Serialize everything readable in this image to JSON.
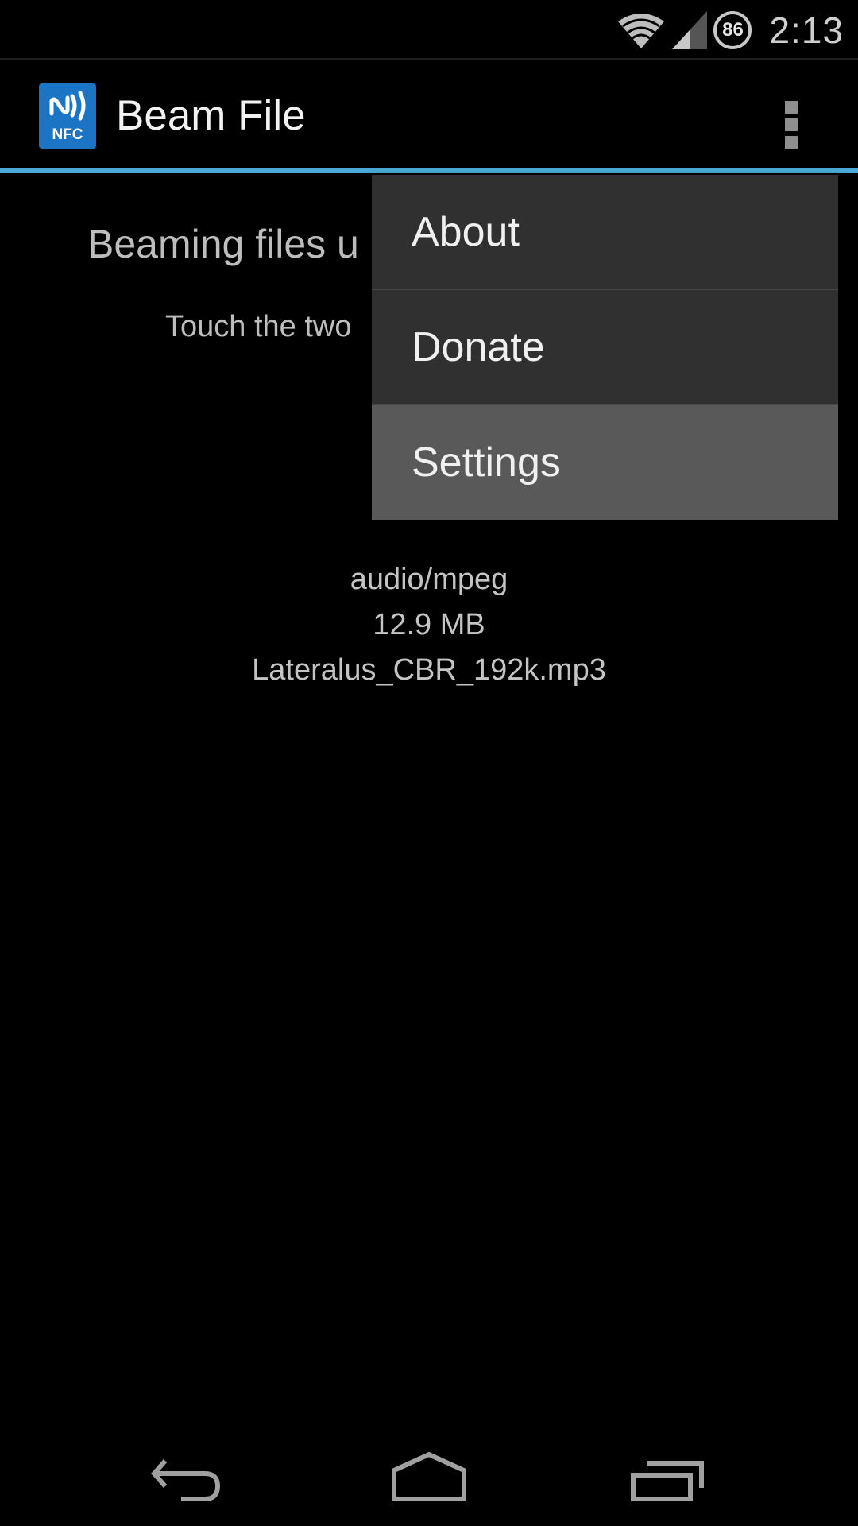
{
  "status_bar": {
    "time": "2:13",
    "battery_level": "86",
    "icons": [
      "wifi-icon",
      "cell-signal-icon",
      "battery-icon"
    ]
  },
  "action_bar": {
    "app_icon_label": "NFC",
    "title": "Beam File",
    "overflow_icon": "overflow-menu-icon"
  },
  "content": {
    "heading": "Beaming files u",
    "subtext": "Touch the two",
    "file": {
      "mime_type": "audio/mpeg",
      "size": "12.9 MB",
      "name": "Lateralus_CBR_192k.mp3"
    }
  },
  "overflow_menu": {
    "items": [
      {
        "label": "About",
        "state": "normal"
      },
      {
        "label": "Donate",
        "state": "normal"
      },
      {
        "label": "Settings",
        "state": "pressed"
      }
    ]
  },
  "nav_bar": {
    "buttons": [
      "back",
      "home",
      "recent-apps"
    ]
  },
  "colors": {
    "accent": "#4aa9d6",
    "app_icon_bg": "#1b74c4",
    "menu_bg": "#303030",
    "menu_pressed_bg": "#595959"
  }
}
